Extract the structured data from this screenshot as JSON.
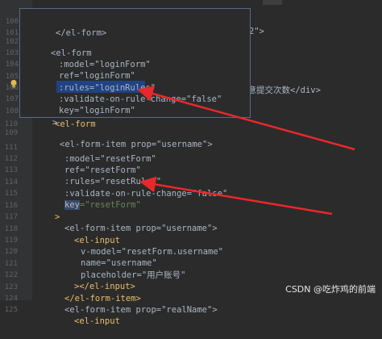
{
  "editor": {
    "main_lines": [
      {
        "n": "101"
      },
      {
        "n": "102"
      },
      {
        "n": "103"
      },
      {
        "n": "104"
      },
      {
        "n": "105"
      },
      {
        "n": "106"
      },
      {
        "n": "107"
      },
      {
        "n": "108"
      },
      {
        "n": "109"
      },
      {
        "n": "110"
      },
      {
        "n": "111"
      },
      {
        "n": "112"
      },
      {
        "n": "113"
      },
      {
        "n": "114"
      },
      {
        "n": "115"
      },
      {
        "n": "116"
      },
      {
        "n": "117"
      },
      {
        "n": "118"
      },
      {
        "n": "119"
      },
      {
        "n": "120"
      },
      {
        "n": "121"
      },
      {
        "n": "122"
      },
      {
        "n": "123"
      },
      {
        "n": "124"
      },
      {
        "n": "125"
      }
    ],
    "code": {
      "l100": "</el-form>",
      "l103_tail": "2\">",
      "l107_tail": "注意提交次数</div>",
      "l109": "<el-form-item prop=\"username\">",
      "l110": "<el-form",
      "l111": ":model=\"resetForm\"",
      "l112": "ref=\"resetForm\"",
      "l113": ":rules=\"resetRules\"",
      "l114": ":validate-on-rule-change=\"false\"",
      "l115_key": "key",
      "l115_rest": "=\"resetForm\"",
      "l116": ">",
      "l117": "<el-form-item prop=\"username\">",
      "l118": "<el-input",
      "l119": "v-model=\"resetForm.username\"",
      "l120": "name=\"username\"",
      "l121": "placeholder=\"用户账号\"",
      "l122": "></el-input>",
      "l123": "</el-form-item>",
      "l124": "<el-form-item prop=\"realName\">",
      "l125": "<el-input"
    },
    "popup": {
      "lines": [
        {
          "n": "100"
        },
        {
          "n": "101"
        },
        {
          "n": "102"
        },
        {
          "n": "103"
        },
        {
          "n": "104"
        },
        {
          "n": "105"
        },
        {
          "n": "106"
        },
        {
          "n": "107"
        },
        {
          "n": "108"
        }
      ],
      "l100": "</el-form>",
      "l102": "<el-form",
      "l103": ":model=\"loginForm\"",
      "l104": "ref=\"loginForm\"",
      "l105": ":rules=\"loginRules\"",
      "l106": ":validate-on-rule-change=\"false\"",
      "l107": "key=\"loginForm\"",
      "l108": ">"
    }
  },
  "watermark": "CSDN @吃炸鸡的前端",
  "colors": {
    "background": "#2b2b2b",
    "arrow": "#e8282c",
    "selection": "#214283",
    "popup_border": "#5a6a8a"
  }
}
